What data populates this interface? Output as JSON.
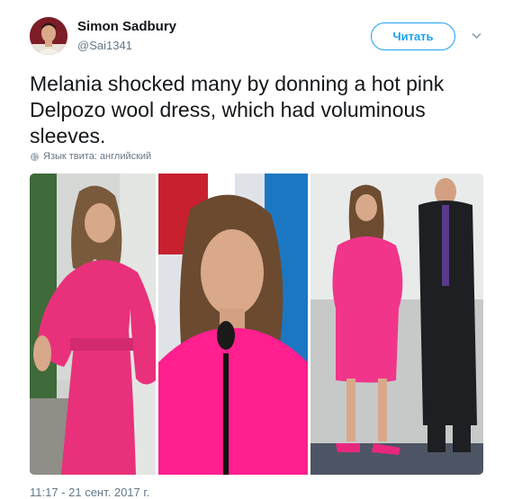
{
  "user": {
    "display_name": "Simon Sadbury",
    "handle": "@Sai1341"
  },
  "follow_button": {
    "label": "Читать"
  },
  "tweet": {
    "lines": [
      "Melania shocked many by donning a hot pink",
      "Delpozo wool dress, which had voluminous",
      "sleeves."
    ],
    "language_note": "Язык твита: английский",
    "timestamp": "11:17 - 21 сент. 2017 г."
  },
  "colors": {
    "accent": "#1da1f2",
    "muted": "#657786",
    "dress_left": "#e8317a",
    "dress_center": "#ff1f8e",
    "dress_right": "#f0358a"
  },
  "icons": [
    "chevron-down-icon",
    "globe-icon"
  ]
}
